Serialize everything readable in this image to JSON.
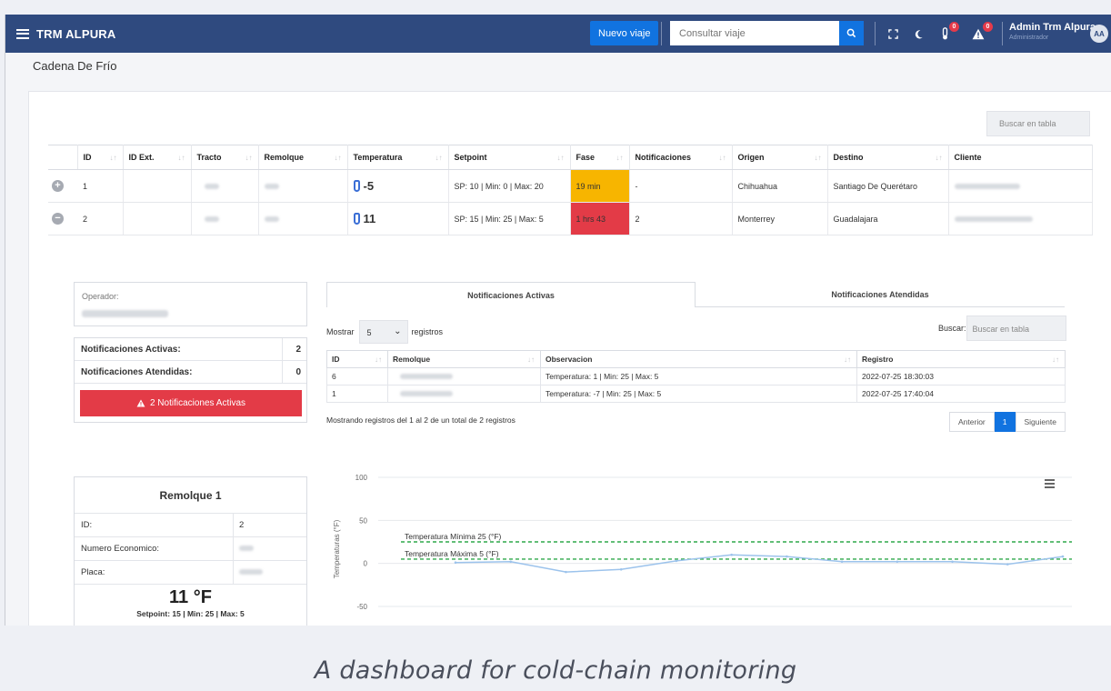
{
  "app": {
    "brand": "TRM ALPURA"
  },
  "topbar": {
    "new_trip_label": "Nuevo viaje",
    "search_placeholder": "Consultar viaje",
    "temp_badge": "0",
    "alert_badge": "0",
    "user_name": "Admin Trm Alpura",
    "user_role": "Administrador",
    "avatar_initials": "AA"
  },
  "page": {
    "title": "Cadena De Frío"
  },
  "main_table": {
    "search_placeholder": "Buscar en tabla",
    "headers": [
      "ID",
      "ID Ext.",
      "Tracto",
      "Remolque",
      "Temperatura",
      "Setpoint",
      "Fase",
      "Notificaciones",
      "Origen",
      "Destino",
      "Cliente"
    ],
    "rows": [
      {
        "expand": "+",
        "id": "1",
        "temperature": "-5",
        "setpoint": "SP: 10 | Min: 0 | Max: 20",
        "fase": "19 min",
        "notifications": "-",
        "origin": "Chihuahua",
        "destination": "Santiago De Querétaro"
      },
      {
        "expand": "−",
        "id": "2",
        "temperature": "11",
        "setpoint": "SP: 15 | Min: 25 | Max: 5",
        "fase": "1 hrs 43",
        "notifications": "2",
        "origin": "Monterrey",
        "destination": "Guadalajara"
      }
    ]
  },
  "detail": {
    "operator_label": "Operador:",
    "active_label": "Notificaciones Activas:",
    "active_count": "2",
    "attended_label": "Notificaciones Atendidas:",
    "attended_count": "0",
    "alert_button": "2 Notificaciones Activas",
    "alert_color": "#e33b47"
  },
  "notifications": {
    "tab_active": "Notificaciones Activas",
    "tab_attended": "Notificaciones Atendidas",
    "show_label": "Mostrar",
    "show_value": "5",
    "records_label": "registros",
    "search_label": "Buscar:",
    "search_placeholder": "Buscar en tabla",
    "headers": [
      "ID",
      "Remolque",
      "Observacion",
      "Registro"
    ],
    "rows": [
      {
        "id": "6",
        "observation": "Temperatura: 1 | Min: 25 | Max: 5",
        "registro": "2022-07-25 18:30:03"
      },
      {
        "id": "1",
        "observation": "Temperatura: -7 | Min: 25 | Max: 5",
        "registro": "2022-07-25 17:40:04"
      }
    ],
    "showing": "Mostrando registros del 1 al 2 de un total de 2 registros",
    "prev": "Anterior",
    "page": "1",
    "next": "Siguiente"
  },
  "trailer": {
    "title": "Remolque 1",
    "id_label": "ID:",
    "id_value": "2",
    "eco_label": "Numero Economico:",
    "plate_label": "Placa:",
    "temperature": "11 °F",
    "setpoint": "Setpoint: 15 | Min: 25 | Max: 5"
  },
  "chart_data": {
    "type": "line",
    "ylabel": "Temperaturas (°F)",
    "ylim": [
      -50,
      100
    ],
    "yticks": [
      100,
      50,
      0,
      -50
    ],
    "series": [
      {
        "values": [
          1,
          2,
          -10,
          -7,
          3,
          10,
          8,
          2,
          2,
          2,
          -1,
          8
        ]
      }
    ],
    "thresholds": [
      {
        "label": "Temperatura Mínima 25 (°F)",
        "value": 25,
        "color": "#2ea84a"
      },
      {
        "label": "Temperatura Máxima 5 (°F)",
        "value": 5,
        "color": "#2ea84a"
      }
    ],
    "line_color": "#9cc3ec"
  },
  "caption": "A dashboard for cold-chain monitoring"
}
